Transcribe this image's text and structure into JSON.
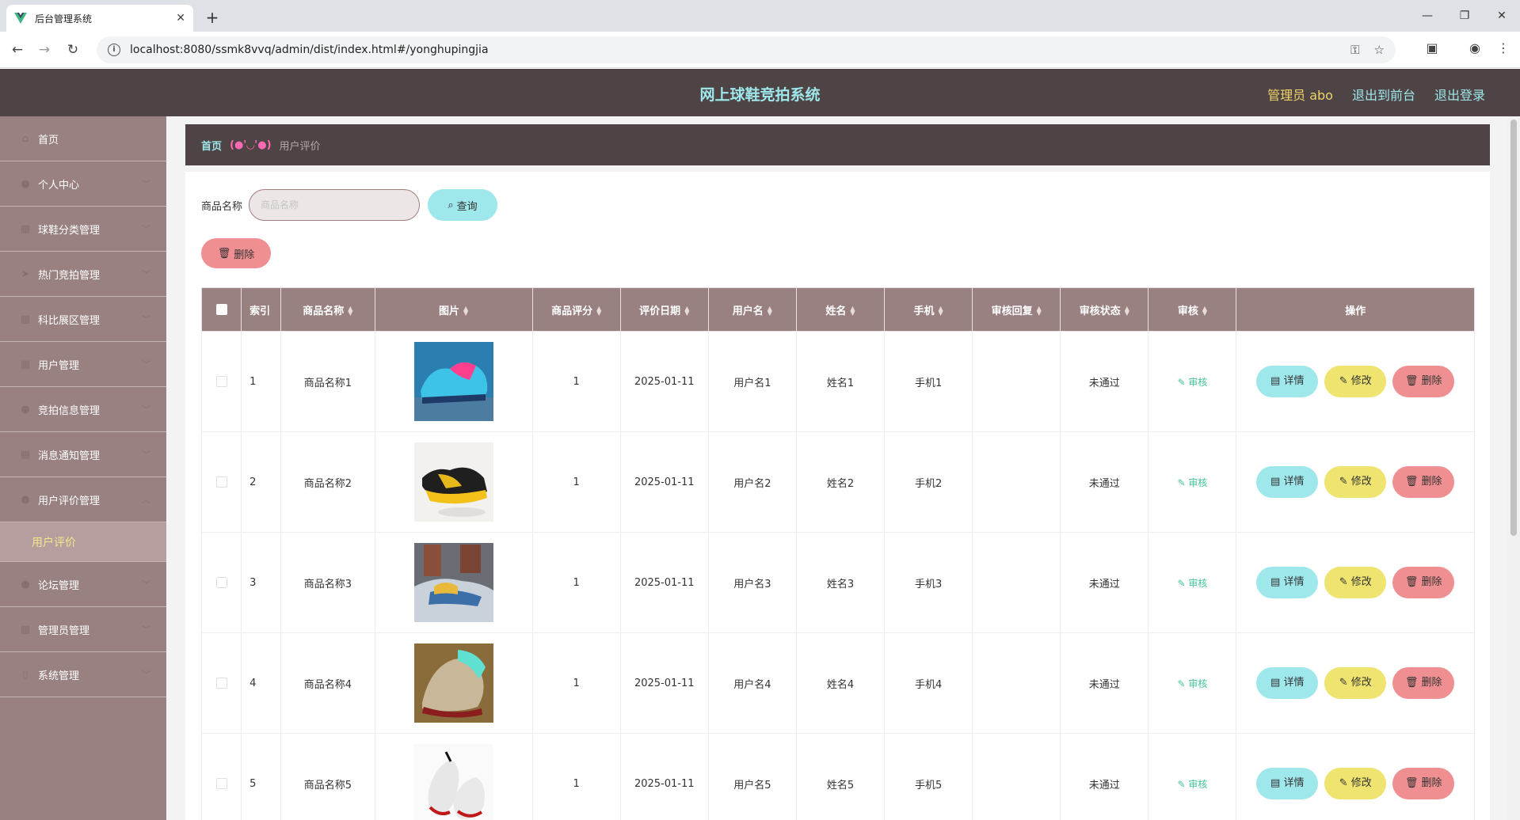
{
  "browser": {
    "tab_title": "后台管理系统",
    "url": "localhost:8080/ssmk8vvq/admin/dist/index.html#/yonghupingjia"
  },
  "header": {
    "title": "网上球鞋竞拍系统",
    "admin": "管理员 abo",
    "to_front": "退出到前台",
    "logout": "退出登录"
  },
  "sidebar": {
    "items": [
      {
        "label": "首页",
        "icon": "home-icon",
        "glyph": "⌂"
      },
      {
        "label": "个人中心",
        "icon": "user-icon",
        "glyph": "●"
      },
      {
        "label": "球鞋分类管理",
        "icon": "grid-icon",
        "glyph": "▦"
      },
      {
        "label": "热门竞拍管理",
        "icon": "send-icon",
        "glyph": "➤"
      },
      {
        "label": "科比展区管理",
        "icon": "grid-icon",
        "glyph": "▦"
      },
      {
        "label": "用户管理",
        "icon": "grid-icon",
        "glyph": "▦"
      },
      {
        "label": "竞拍信息管理",
        "icon": "pin-icon",
        "glyph": "●"
      },
      {
        "label": "消息通知管理",
        "icon": "grid-icon",
        "glyph": "▦"
      },
      {
        "label": "用户评价管理",
        "icon": "user-icon",
        "glyph": "●"
      },
      {
        "label": "用户评价",
        "icon": "",
        "glyph": ""
      },
      {
        "label": "论坛管理",
        "icon": "user-icon",
        "glyph": "●"
      },
      {
        "label": "管理员管理",
        "icon": "grid-icon",
        "glyph": "▦"
      },
      {
        "label": "系统管理",
        "icon": "doc-icon",
        "glyph": "▯"
      }
    ]
  },
  "breadcrumb": {
    "home": "首页",
    "sep": "(●'◡'●)",
    "current": "用户评价"
  },
  "search": {
    "label": "商品名称",
    "placeholder": "商品名称",
    "query_btn": "查询",
    "delete_btn": "删除"
  },
  "table": {
    "headers": [
      "索引",
      "商品名称",
      "图片",
      "商品评分",
      "评价日期",
      "用户名",
      "姓名",
      "手机",
      "审核回复",
      "审核状态",
      "审核",
      "操作"
    ],
    "rows": [
      {
        "index": "1",
        "name": "商品名称1",
        "score": "1",
        "date": "2025-01-11",
        "username": "用户名1",
        "realname": "姓名1",
        "phone": "手机1",
        "reply": "",
        "status": "未通过",
        "audit": "审核",
        "img": "blue"
      },
      {
        "index": "2",
        "name": "商品名称2",
        "score": "1",
        "date": "2025-01-11",
        "username": "用户名2",
        "realname": "姓名2",
        "phone": "手机2",
        "reply": "",
        "status": "未通过",
        "audit": "审核",
        "img": "yellow"
      },
      {
        "index": "3",
        "name": "商品名称3",
        "score": "1",
        "date": "2025-01-11",
        "username": "用户名3",
        "realname": "姓名3",
        "phone": "手机3",
        "reply": "",
        "status": "未通过",
        "audit": "审核",
        "img": "lacing"
      },
      {
        "index": "4",
        "name": "商品名称4",
        "score": "1",
        "date": "2025-01-11",
        "username": "用户名4",
        "realname": "姓名4",
        "phone": "手机4",
        "reply": "",
        "status": "未通过",
        "audit": "审核",
        "img": "glow"
      },
      {
        "index": "5",
        "name": "商品名称5",
        "score": "1",
        "date": "2025-01-11",
        "username": "用户名5",
        "realname": "姓名5",
        "phone": "手机5",
        "reply": "",
        "status": "未通过",
        "audit": "审核",
        "img": "white"
      }
    ],
    "op_detail": "详情",
    "op_edit": "修改",
    "op_delete": "删除"
  },
  "colors": {
    "header_bg": "#4e4445",
    "sidebar_bg": "#998081",
    "accent_cyan": "#9ee7eb",
    "accent_yellow": "#eee46f",
    "accent_red": "#ef8f92"
  }
}
